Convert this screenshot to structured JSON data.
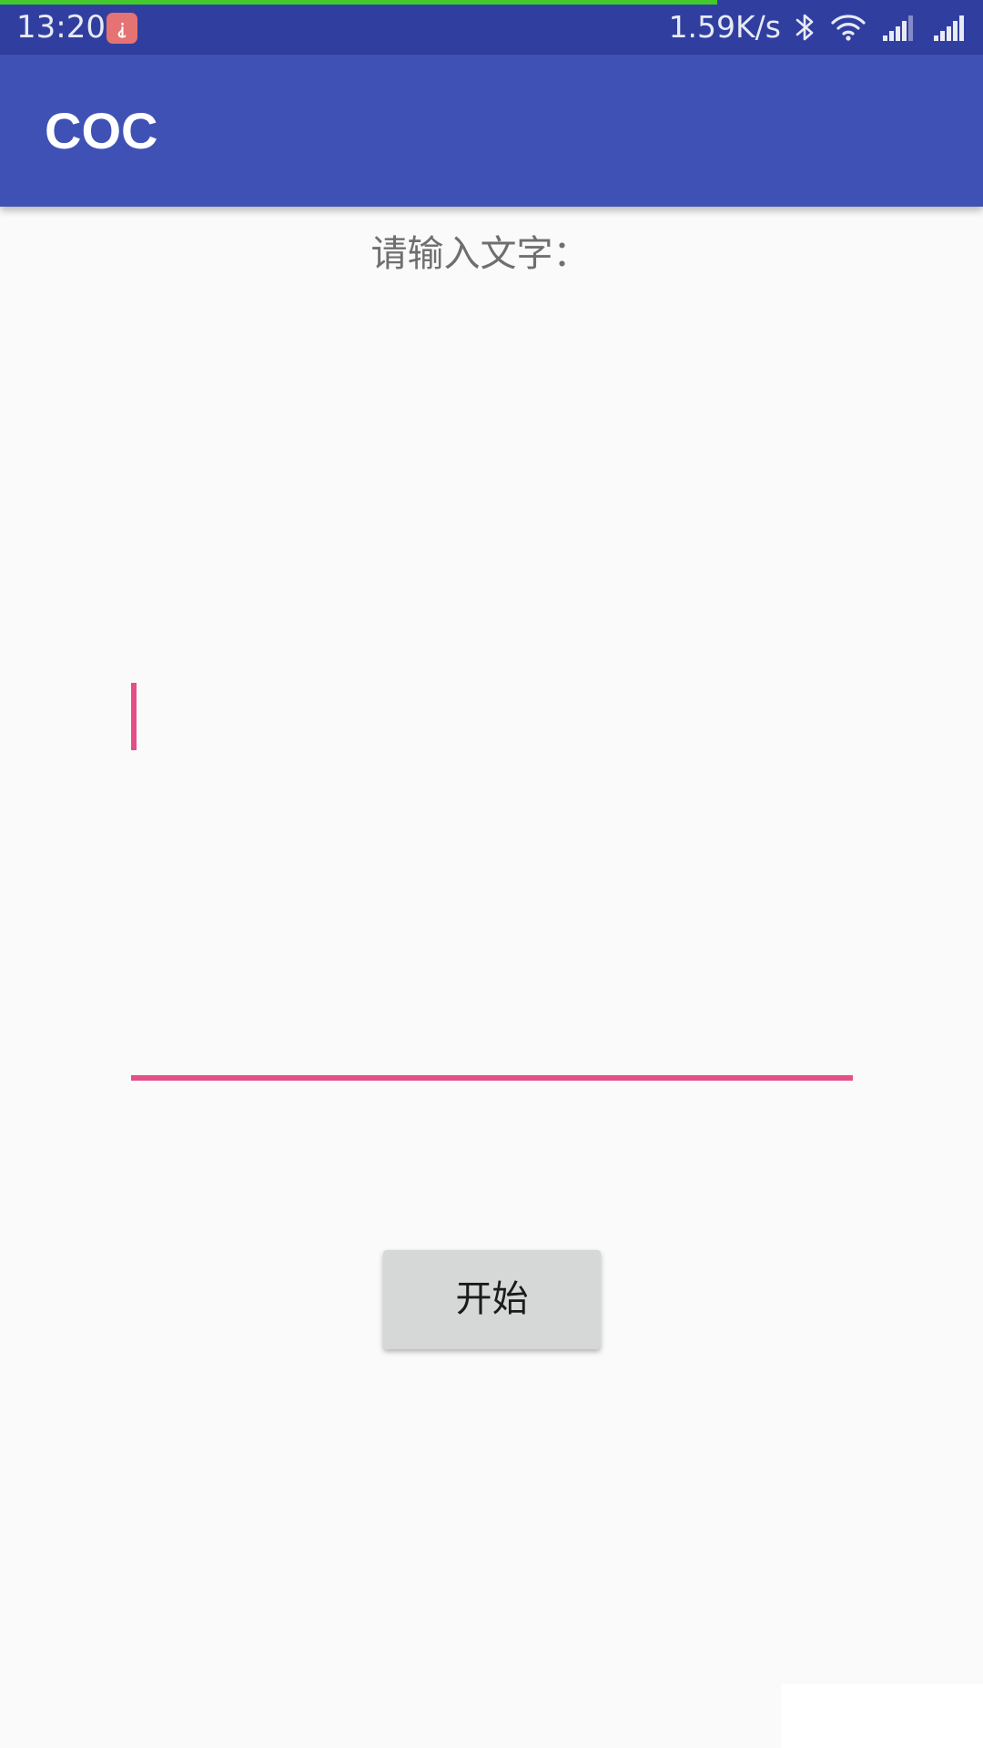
{
  "status_bar": {
    "time": "13:20",
    "notification_glyph": "⸘",
    "net_speed": "1.59K/s",
    "page_load_progress": 0.73,
    "icons": [
      "bluetooth-icon",
      "wifi-icon",
      "cell-signal-icon",
      "cell-signal-icon"
    ],
    "colors": {
      "background": "#303f9f",
      "progress": "#43c92b",
      "badge": "#e57373"
    }
  },
  "app_bar": {
    "title": "COC",
    "color": "#3f51b5"
  },
  "form": {
    "prompt_label": "请输入文字：",
    "text_value": "",
    "accent_color": "#e54f87",
    "start_button_label": "开始"
  }
}
